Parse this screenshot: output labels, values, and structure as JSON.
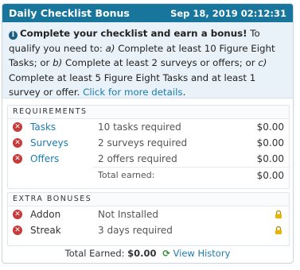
{
  "header": {
    "title": "Daily Checklist Bonus",
    "datetime": "Sep 18, 2019 02:12:31"
  },
  "info": {
    "icon": "info-icon",
    "lead": "Complete your checklist and earn a bonus!",
    "text_1": " To qualify you need to: ",
    "a_marker": "a)",
    "text_a": " Complete at least 10 Figure Eight Tasks; ",
    "or_1": "or ",
    "b_marker": "b)",
    "text_b": " Complete at least 2 surveys or offers; or ",
    "c_marker": "c)",
    "text_c": " Complete at least 5 Figure Eight Tasks and at least 1 survey or offer. ",
    "link": "Click for more details",
    "end": "."
  },
  "requirements": {
    "title": "REQUIREMENTS",
    "items": [
      {
        "name": "Tasks",
        "desc": "10 tasks required",
        "amount": "$0.00"
      },
      {
        "name": "Surveys",
        "desc": "2 surveys required",
        "amount": "$0.00"
      },
      {
        "name": "Offers",
        "desc": "2 offers required",
        "amount": "$0.00"
      }
    ],
    "total_label": "Total earned:",
    "total_amount": "$0.00"
  },
  "extra_bonuses": {
    "title": "EXTRA BONUSES",
    "items": [
      {
        "name": "Addon",
        "desc": "Not Installed",
        "icon": "lock-icon"
      },
      {
        "name": "Streak",
        "desc": "3 days required",
        "icon": "lock-icon"
      }
    ]
  },
  "footer": {
    "label": "Total Earned:",
    "amount": "$0.00",
    "link": "View History"
  },
  "colors": {
    "header_bg": "#18759c",
    "info_bg": "#e9f2f8",
    "link": "#1b7cb0",
    "error": "#c63b3b",
    "lock": "#e8b400",
    "refresh": "#2e8b3a"
  }
}
